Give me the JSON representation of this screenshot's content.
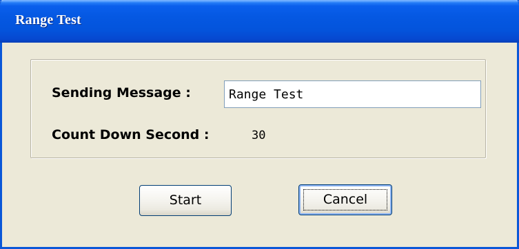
{
  "window": {
    "title": "Range Test"
  },
  "form": {
    "sending_message_label": "Sending Message :",
    "sending_message_value": "Range Test",
    "count_down_label": "Count Down Second :",
    "count_down_value": "30"
  },
  "buttons": {
    "start_label": "Start",
    "cancel_label": "Cancel"
  },
  "colors": {
    "titlebar": "#0558E2",
    "window_bg": "#ECE9D8",
    "button_border": "#003C74"
  }
}
